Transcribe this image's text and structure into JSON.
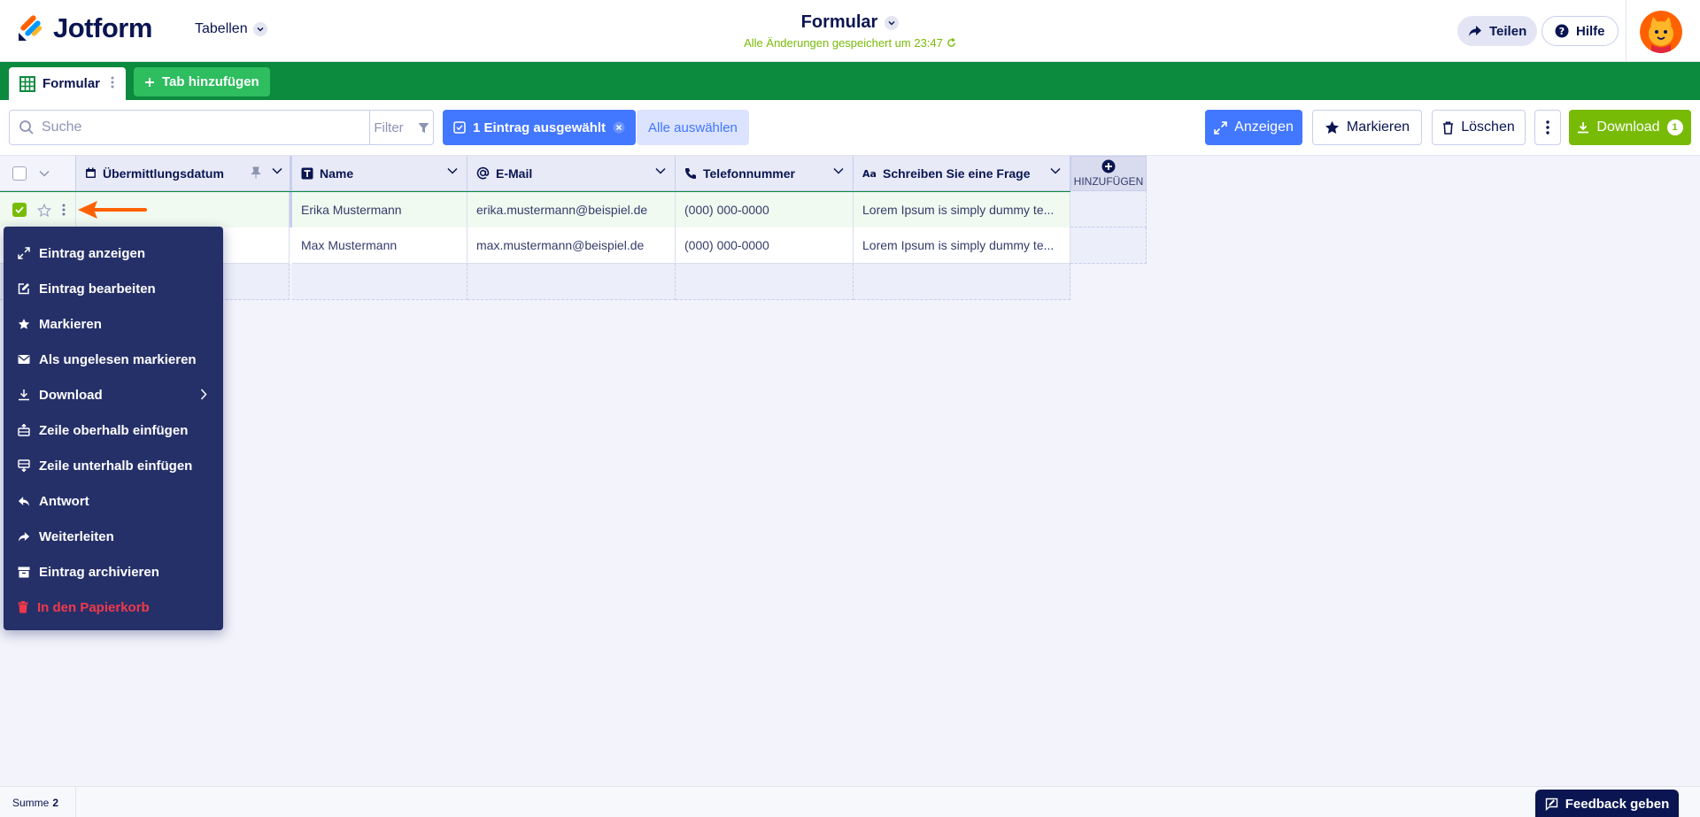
{
  "header": {
    "logo_text": "Jotform",
    "tables_label": "Tabellen",
    "form_title": "Formular",
    "saved_status": "Alle Änderungen gespeichert um 23:47",
    "share_label": "Teilen",
    "help_label": "Hilfe"
  },
  "tabs": {
    "active_label": "Formular",
    "add_label": "Tab hinzufügen"
  },
  "toolbar": {
    "search_placeholder": "Suche",
    "filter_label": "Filter",
    "selected_label": "1 Eintrag ausgewählt",
    "select_all_label": "Alle auswählen",
    "view_label": "Anzeigen",
    "star_label": "Markieren",
    "delete_label": "Löschen",
    "download_label": "Download",
    "download_count": "1"
  },
  "table": {
    "columns": [
      {
        "label": "Übermittlungsdatum",
        "icon": "calendar-icon"
      },
      {
        "label": "Name",
        "icon": "text-icon"
      },
      {
        "label": "E-Mail",
        "icon": "at-icon"
      },
      {
        "label": "Telefonnummer",
        "icon": "phone-icon"
      },
      {
        "label": "Schreiben Sie eine Frage",
        "icon": "aa-icon"
      }
    ],
    "add_column_label": "HINZUFÜGEN",
    "rows": [
      {
        "date": "",
        "name": "Erika Mustermann",
        "email": "erika.mustermann@beispiel.de",
        "phone": "(000) 000-0000",
        "question": "Lorem Ipsum is simply dummy te...",
        "selected": true
      },
      {
        "date": "",
        "name": "Max Mustermann",
        "email": "max.mustermann@beispiel.de",
        "phone": "(000) 000-0000",
        "question": "Lorem Ipsum is simply dummy te...",
        "selected": false
      }
    ]
  },
  "context_menu": {
    "items": [
      {
        "label": "Eintrag anzeigen",
        "icon": "expand-icon"
      },
      {
        "label": "Eintrag bearbeiten",
        "icon": "edit-icon"
      },
      {
        "label": "Markieren",
        "icon": "star-icon"
      },
      {
        "label": "Als ungelesen markieren",
        "icon": "envelope-icon"
      },
      {
        "label": "Download",
        "icon": "download-icon",
        "has_submenu": true
      },
      {
        "label": "Zeile oberhalb einfügen",
        "icon": "row-above-icon"
      },
      {
        "label": "Zeile unterhalb einfügen",
        "icon": "row-below-icon"
      },
      {
        "label": "Antwort",
        "icon": "reply-icon"
      },
      {
        "label": "Weiterleiten",
        "icon": "forward-icon"
      },
      {
        "label": "Eintrag archivieren",
        "icon": "archive-icon"
      },
      {
        "label": "In den Papierkorb",
        "icon": "trash-icon",
        "danger": true
      }
    ]
  },
  "footer": {
    "sum_label": "Summe",
    "sum_value": "2",
    "feedback_label": "Feedback geben"
  },
  "colors": {
    "brand_green": "#0c8a3e",
    "accent_blue": "#4277ff",
    "download_green": "#78bb07",
    "navy": "#0a1551",
    "menu_bg": "#253069",
    "danger": "#f2384a",
    "arrow_orange": "#ff6100"
  }
}
